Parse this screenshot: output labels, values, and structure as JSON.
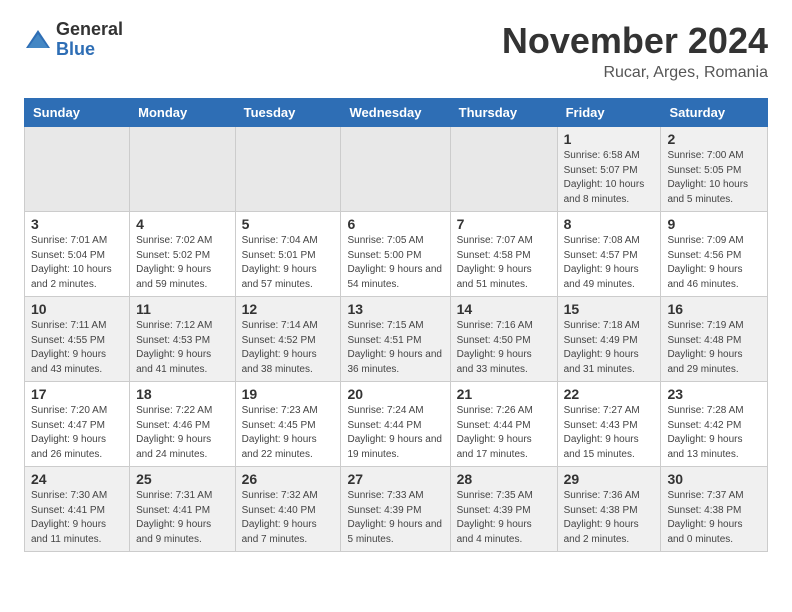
{
  "header": {
    "logo_general": "General",
    "logo_blue": "Blue",
    "month_title": "November 2024",
    "location": "Rucar, Arges, Romania"
  },
  "days_of_week": [
    "Sunday",
    "Monday",
    "Tuesday",
    "Wednesday",
    "Thursday",
    "Friday",
    "Saturday"
  ],
  "weeks": [
    [
      {
        "day": "",
        "info": ""
      },
      {
        "day": "",
        "info": ""
      },
      {
        "day": "",
        "info": ""
      },
      {
        "day": "",
        "info": ""
      },
      {
        "day": "",
        "info": ""
      },
      {
        "day": "1",
        "info": "Sunrise: 6:58 AM\nSunset: 5:07 PM\nDaylight: 10 hours and 8 minutes."
      },
      {
        "day": "2",
        "info": "Sunrise: 7:00 AM\nSunset: 5:05 PM\nDaylight: 10 hours and 5 minutes."
      }
    ],
    [
      {
        "day": "3",
        "info": "Sunrise: 7:01 AM\nSunset: 5:04 PM\nDaylight: 10 hours and 2 minutes."
      },
      {
        "day": "4",
        "info": "Sunrise: 7:02 AM\nSunset: 5:02 PM\nDaylight: 9 hours and 59 minutes."
      },
      {
        "day": "5",
        "info": "Sunrise: 7:04 AM\nSunset: 5:01 PM\nDaylight: 9 hours and 57 minutes."
      },
      {
        "day": "6",
        "info": "Sunrise: 7:05 AM\nSunset: 5:00 PM\nDaylight: 9 hours and 54 minutes."
      },
      {
        "day": "7",
        "info": "Sunrise: 7:07 AM\nSunset: 4:58 PM\nDaylight: 9 hours and 51 minutes."
      },
      {
        "day": "8",
        "info": "Sunrise: 7:08 AM\nSunset: 4:57 PM\nDaylight: 9 hours and 49 minutes."
      },
      {
        "day": "9",
        "info": "Sunrise: 7:09 AM\nSunset: 4:56 PM\nDaylight: 9 hours and 46 minutes."
      }
    ],
    [
      {
        "day": "10",
        "info": "Sunrise: 7:11 AM\nSunset: 4:55 PM\nDaylight: 9 hours and 43 minutes."
      },
      {
        "day": "11",
        "info": "Sunrise: 7:12 AM\nSunset: 4:53 PM\nDaylight: 9 hours and 41 minutes."
      },
      {
        "day": "12",
        "info": "Sunrise: 7:14 AM\nSunset: 4:52 PM\nDaylight: 9 hours and 38 minutes."
      },
      {
        "day": "13",
        "info": "Sunrise: 7:15 AM\nSunset: 4:51 PM\nDaylight: 9 hours and 36 minutes."
      },
      {
        "day": "14",
        "info": "Sunrise: 7:16 AM\nSunset: 4:50 PM\nDaylight: 9 hours and 33 minutes."
      },
      {
        "day": "15",
        "info": "Sunrise: 7:18 AM\nSunset: 4:49 PM\nDaylight: 9 hours and 31 minutes."
      },
      {
        "day": "16",
        "info": "Sunrise: 7:19 AM\nSunset: 4:48 PM\nDaylight: 9 hours and 29 minutes."
      }
    ],
    [
      {
        "day": "17",
        "info": "Sunrise: 7:20 AM\nSunset: 4:47 PM\nDaylight: 9 hours and 26 minutes."
      },
      {
        "day": "18",
        "info": "Sunrise: 7:22 AM\nSunset: 4:46 PM\nDaylight: 9 hours and 24 minutes."
      },
      {
        "day": "19",
        "info": "Sunrise: 7:23 AM\nSunset: 4:45 PM\nDaylight: 9 hours and 22 minutes."
      },
      {
        "day": "20",
        "info": "Sunrise: 7:24 AM\nSunset: 4:44 PM\nDaylight: 9 hours and 19 minutes."
      },
      {
        "day": "21",
        "info": "Sunrise: 7:26 AM\nSunset: 4:44 PM\nDaylight: 9 hours and 17 minutes."
      },
      {
        "day": "22",
        "info": "Sunrise: 7:27 AM\nSunset: 4:43 PM\nDaylight: 9 hours and 15 minutes."
      },
      {
        "day": "23",
        "info": "Sunrise: 7:28 AM\nSunset: 4:42 PM\nDaylight: 9 hours and 13 minutes."
      }
    ],
    [
      {
        "day": "24",
        "info": "Sunrise: 7:30 AM\nSunset: 4:41 PM\nDaylight: 9 hours and 11 minutes."
      },
      {
        "day": "25",
        "info": "Sunrise: 7:31 AM\nSunset: 4:41 PM\nDaylight: 9 hours and 9 minutes."
      },
      {
        "day": "26",
        "info": "Sunrise: 7:32 AM\nSunset: 4:40 PM\nDaylight: 9 hours and 7 minutes."
      },
      {
        "day": "27",
        "info": "Sunrise: 7:33 AM\nSunset: 4:39 PM\nDaylight: 9 hours and 5 minutes."
      },
      {
        "day": "28",
        "info": "Sunrise: 7:35 AM\nSunset: 4:39 PM\nDaylight: 9 hours and 4 minutes."
      },
      {
        "day": "29",
        "info": "Sunrise: 7:36 AM\nSunset: 4:38 PM\nDaylight: 9 hours and 2 minutes."
      },
      {
        "day": "30",
        "info": "Sunrise: 7:37 AM\nSunset: 4:38 PM\nDaylight: 9 hours and 0 minutes."
      }
    ]
  ]
}
